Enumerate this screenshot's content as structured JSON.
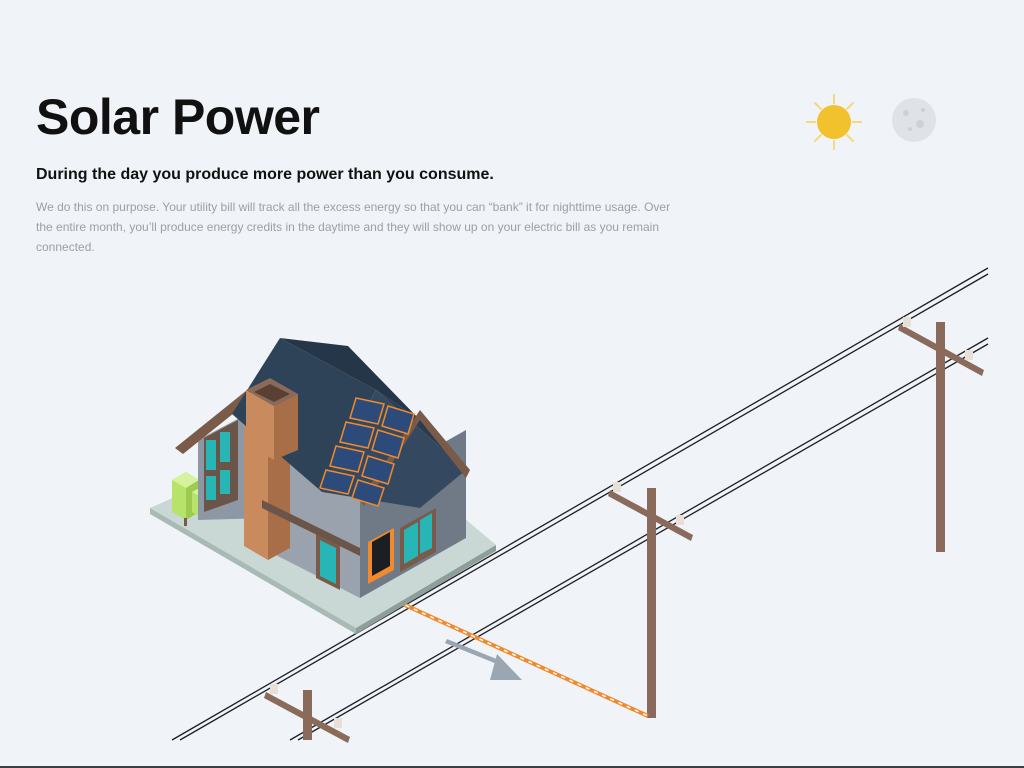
{
  "header": {
    "title": "Solar Power",
    "subtitle": "During the day you produce more power than you consume.",
    "body": "We do this on purpose. Your utility bill will track all the excess energy so that you can “bank” it for nighttime usage. Over the entire month, you’ll produce energy credits in the daytime and they will show up on your electric bill as you remain connected."
  },
  "mode_toggle": {
    "active": "day",
    "day_icon": "sun-icon",
    "night_icon": "moon-icon"
  },
  "colors": {
    "background": "#f0f3f8",
    "sun": "#f2c12e",
    "sun_rays": "#f5d87a",
    "moon": "#dfe2e6",
    "roof": "#2f4358",
    "wall": "#8e98a4",
    "brick": "#c98a5e",
    "window": "#28b5b5",
    "trim": "#7a5a48",
    "pole": "#8a6a5a",
    "energy_line": "#f08a2c",
    "tree": "#b7e36b",
    "ground": "#c9d8d4",
    "flow_arrow": "#9aa6b2"
  },
  "illustration": {
    "scene_icon": "house-with-solar-panels-icon",
    "power_pole_icon": "utility-pole-icon",
    "flow_icon": "energy-flow-arrow-icon"
  }
}
